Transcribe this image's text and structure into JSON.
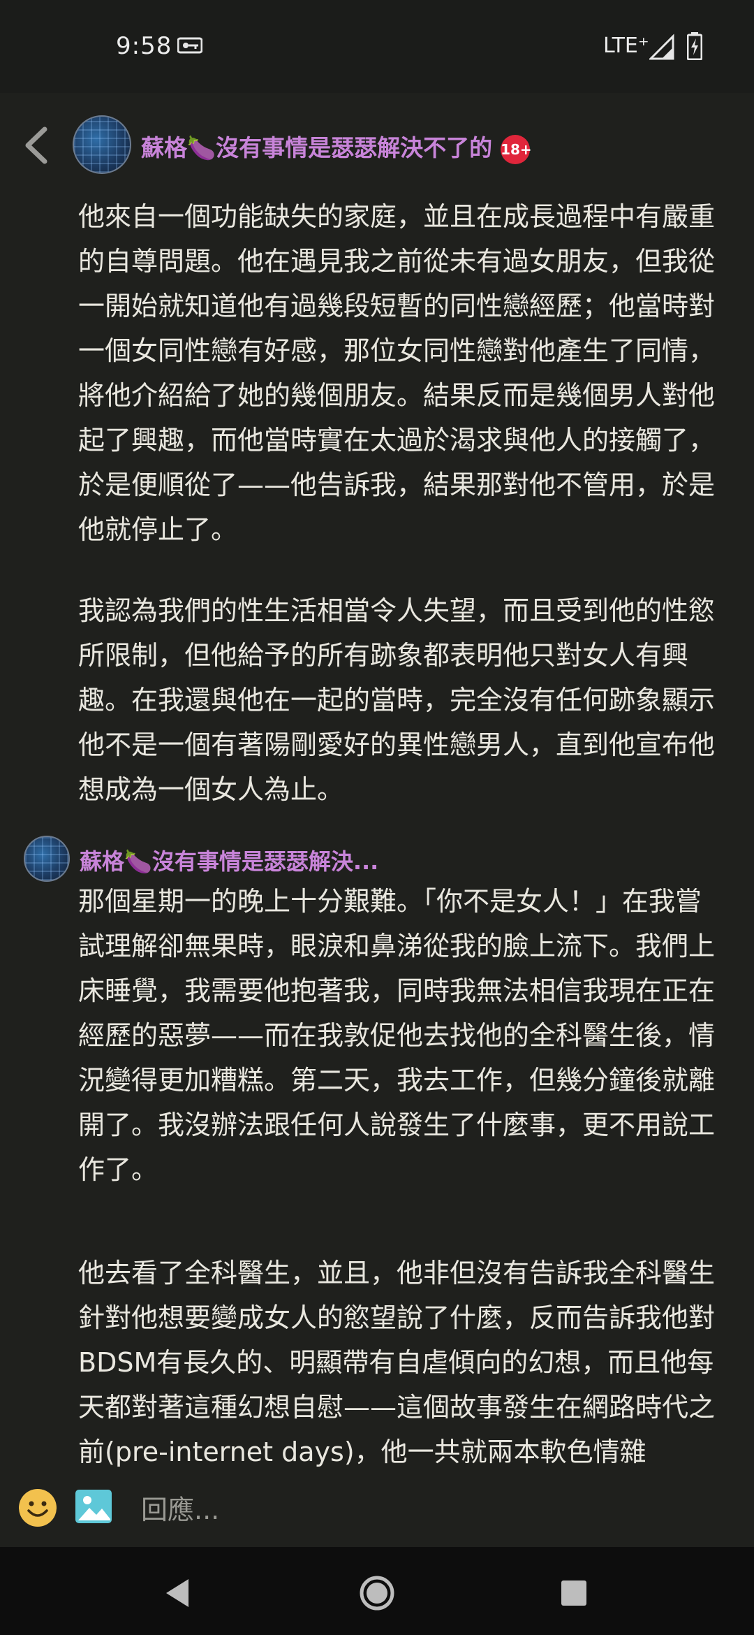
{
  "status_bar": {
    "time": "9:58",
    "network": "LTE⁺"
  },
  "header": {
    "title": "蘇格🍆沒有事情是瑟瑟解決不了的",
    "badge": "18+"
  },
  "message1": {
    "paragraphs": [
      "他來自一個功能缺失的家庭，並且在成長過程中有嚴重的自尊問題。他在遇見我之前從未有過女朋友，但我從一開始就知道他有過幾段短暫的同性戀經歷；他當時對一個女同性戀有好感，那位女同性戀對他產生了同情，將他介紹給了她的幾個朋友。結果反而是幾個男人對他起了興趣，而他當時實在太過於渴求與他人的接觸了，於是便順從了——他告訴我，結果那對他不管用，於是他就停止了。",
      "我認為我們的性生活相當令人失望，而且受到他的性慾所限制，但他給予的所有跡象都表明他只對女人有興趣。在我還與他在一起的當時，完全沒有任何跡象顯示他不是一個有著陽剛愛好的異性戀男人，直到他宣布他想成為一個女人為止。"
    ]
  },
  "message2": {
    "author": "蘇格🍆沒有事情是瑟瑟解決...",
    "paragraphs": [
      "那個星期一的晚上十分艱難。「你不是女人！」在我嘗試理解卻無果時，眼淚和鼻涕從我的臉上流下。我們上床睡覺，我需要他抱著我，同時我無法相信我現在正在經歷的惡夢——而在我敦促他去找他的全科醫生後，情況變得更加糟糕。第二天，我去工作，但幾分鐘後就離開了。我沒辦法跟任何人說發生了什麼事，更不用說工作了。",
      "他去看了全科醫生，並且，他非但沒有告訴我全科醫生針對他想要變成女人的慾望說了什麼，反而告訴我他對BDSM有長久的、明顯帶有自虐傾向的幻想，而且他每天都對著這種幻想自慰——這個故事發生在網路時代之前(pre-internet days)，他一共就兩本軟色情雜"
    ]
  },
  "reply": {
    "placeholder": "回應..."
  },
  "colors": {
    "accent": "#c884d9",
    "badge": "#e0263b",
    "background": "#1f201d"
  }
}
